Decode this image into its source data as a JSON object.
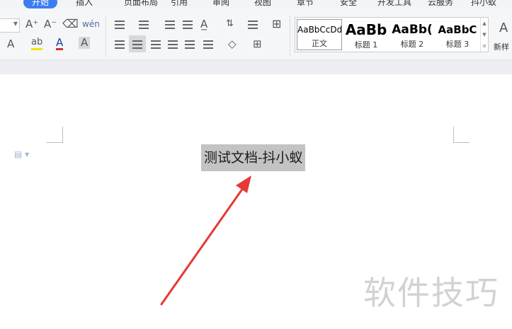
{
  "menu": {
    "tabs": [
      "开始",
      "插入",
      "页面布局",
      "引用",
      "审阅",
      "视图",
      "章节",
      "安全",
      "开发工具",
      "云服务",
      "抖小蚁"
    ],
    "active_index": 0
  },
  "ribbon": {
    "font_grow_icon": "A⁺",
    "font_shrink_icon": "A⁻",
    "eraser_icon": "eraser-icon",
    "phonetic_label": "wén",
    "text_effect_label": "A",
    "highlight_label": "ab",
    "font_color_label": "A",
    "char_shading_label": "A",
    "paragraph_mark": "¶"
  },
  "styles": {
    "items": [
      {
        "sample": "AaBbCcDd",
        "name": "正文"
      },
      {
        "sample": "AaBb",
        "name": "标题 1"
      },
      {
        "sample": "AaBb(",
        "name": "标题 2"
      },
      {
        "sample": "AaBbC",
        "name": "标题 3"
      }
    ],
    "new_style_label": "新样"
  },
  "document": {
    "selected_text": "测试文档-抖小蚁"
  },
  "watermark": "软件技巧",
  "colors": {
    "accent": "#3b7df0",
    "selection": "#c3c3c3",
    "arrow": "#e53935",
    "watermark": "#d2d2d2"
  }
}
